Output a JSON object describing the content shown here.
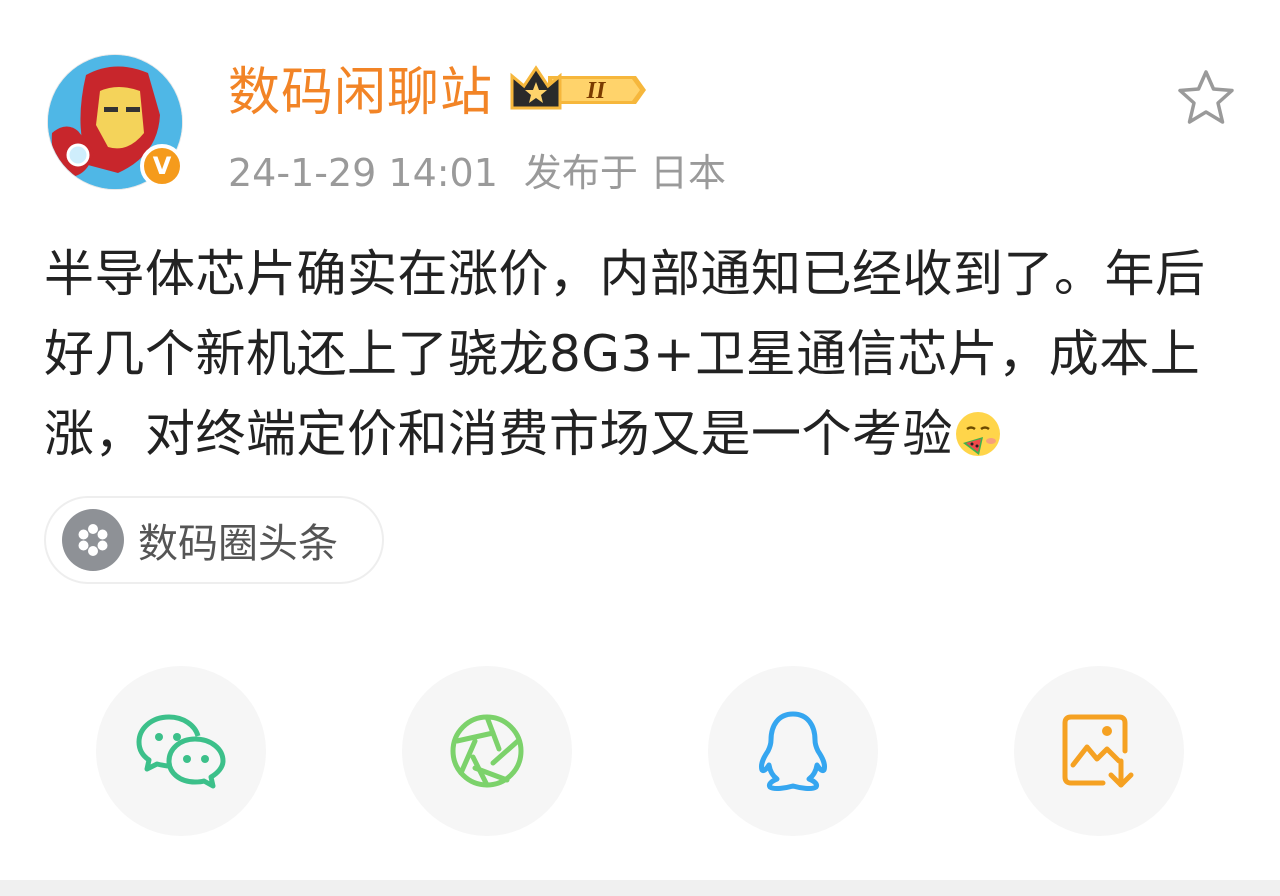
{
  "post": {
    "author": "数码闲聊站",
    "level_badge": "II",
    "verified_mark": "V",
    "timestamp": "24-1-29 14:01",
    "location": "发布于 日本",
    "text": "半导体芯片确实在涨价，内部通知已经收到了。年后好几个新机还上了骁龙8G3+卫星通信芯片，成本上涨，对终端定价和消费市场又是一个考验",
    "topic": "数码圈头条"
  },
  "icons": {
    "favorite": "star-outline-icon",
    "share_targets": [
      "wechat-icon",
      "moments-icon",
      "qq-icon",
      "save-image-icon"
    ]
  },
  "colors": {
    "username": "#f28426",
    "meta": "#9a9a9a",
    "text": "#222222",
    "wechat": "#3cc08a",
    "moments": "#7cd26b",
    "qq": "#35a6f0",
    "save": "#f5a122"
  }
}
